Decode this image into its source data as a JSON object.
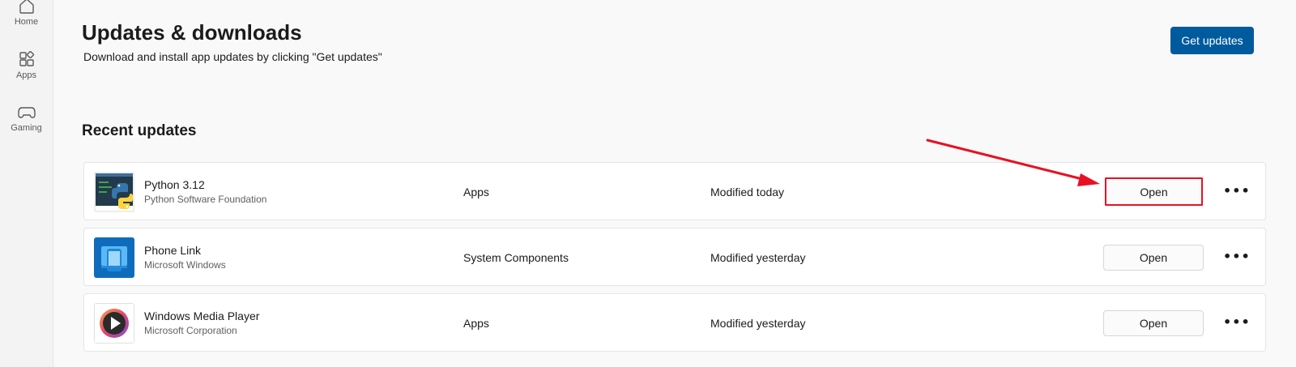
{
  "sidebar": {
    "items": [
      {
        "label": "Home",
        "icon": "home-icon"
      },
      {
        "label": "Apps",
        "icon": "apps-icon"
      },
      {
        "label": "Gaming",
        "icon": "gaming-icon"
      }
    ]
  },
  "header": {
    "title": "Updates & downloads",
    "subtitle": "Download and install app updates by clicking \"Get updates\"",
    "get_updates_label": "Get updates"
  },
  "recent": {
    "title": "Recent updates",
    "items": [
      {
        "name": "Python 3.12",
        "publisher": "Python Software Foundation",
        "category": "Apps",
        "modified": "Modified today",
        "action": "Open",
        "more": "•••",
        "icon": "python-icon",
        "highlighted": true
      },
      {
        "name": "Phone Link",
        "publisher": "Microsoft Windows",
        "category": "System Components",
        "modified": "Modified yesterday",
        "action": "Open",
        "more": "•••",
        "icon": "phone-link-icon",
        "highlighted": false
      },
      {
        "name": "Windows Media Player",
        "publisher": "Microsoft Corporation",
        "category": "Apps",
        "modified": "Modified yesterday",
        "action": "Open",
        "more": "•••",
        "icon": "media-player-icon",
        "highlighted": false
      }
    ]
  },
  "colors": {
    "accent": "#005a9e",
    "annotation": "#e81123"
  }
}
